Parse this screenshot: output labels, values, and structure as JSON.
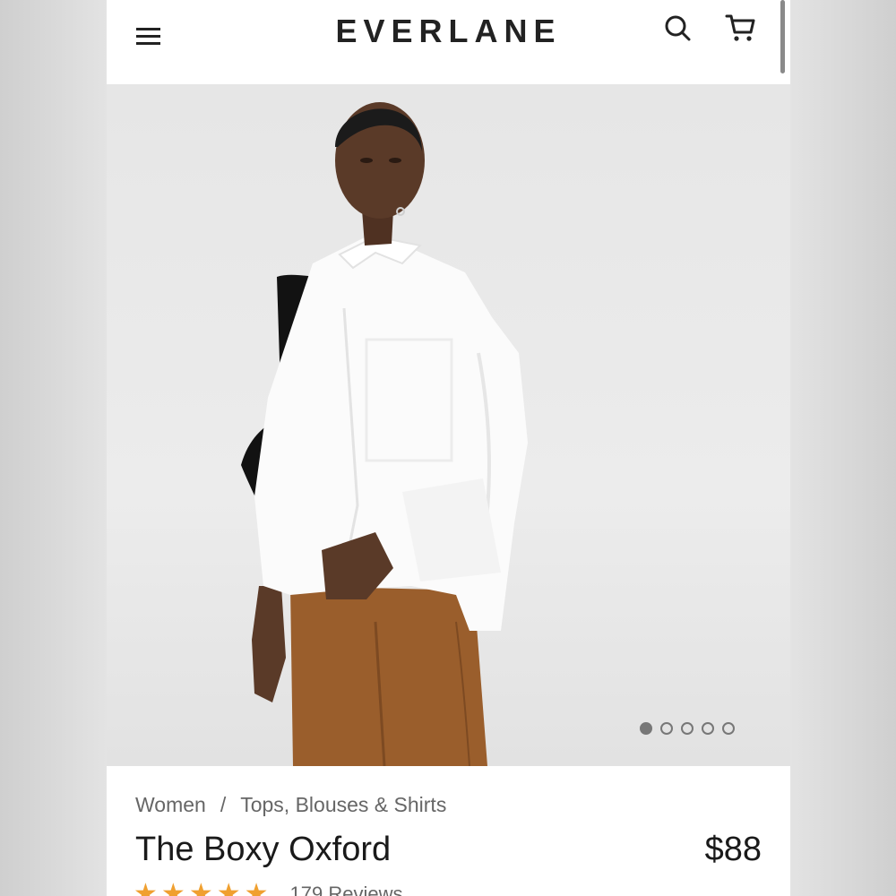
{
  "header": {
    "brand": "EVERLANE",
    "menu_icon": "hamburger-menu-icon",
    "search_icon": "search-icon",
    "cart_icon": "cart-icon"
  },
  "gallery": {
    "slide_count": 5,
    "active_slide": 1
  },
  "product": {
    "breadcrumb": [
      "Women",
      "/",
      "Tops, Blouses & Shirts"
    ],
    "title": "The Boxy Oxford",
    "price": "$88",
    "rating": 5,
    "reviews": "179 Reviews"
  },
  "colors": {
    "star": "#f0a030",
    "text": "#1a1a1a",
    "muted": "#666666"
  }
}
